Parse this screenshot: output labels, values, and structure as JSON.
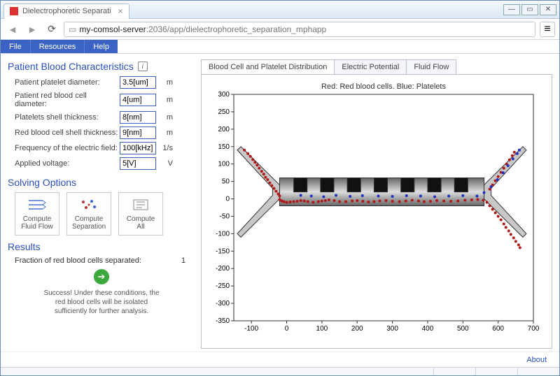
{
  "window": {
    "tab_title": "Dielectrophoretic Separati",
    "url_host": "my-comsol-server",
    "url_port": ":2036",
    "url_path": "/app/dielectrophoretic_separation_mphapp"
  },
  "menubar": [
    "File",
    "Resources",
    "Help"
  ],
  "sections": {
    "pbc_title": "Patient Blood Characteristics",
    "solving_title": "Solving Options",
    "results_title": "Results"
  },
  "fields": [
    {
      "label": "Patient platelet diameter:",
      "value": "3.5[um]",
      "unit": "m"
    },
    {
      "label": "Patient red blood cell diameter:",
      "value": "4[um]",
      "unit": "m"
    },
    {
      "label": "Platelets shell thickness:",
      "value": "8[nm]",
      "unit": "m"
    },
    {
      "label": "Red blood cell shell thickness:",
      "value": "9[nm]",
      "unit": "m"
    },
    {
      "label": "Frequency of the electric field:",
      "value": "100[kHz]",
      "unit": "1/s"
    },
    {
      "label": "Applied voltage:",
      "value": "5[V]",
      "unit": "V"
    }
  ],
  "buttons": {
    "compute_flow": "Compute\nFluid Flow",
    "compute_sep": "Compute\nSeparation",
    "compute_all": "Compute\nAll"
  },
  "results": {
    "fraction_label": "Fraction of red blood cells separated:",
    "fraction_value": "1",
    "success_msg": "Success! Under these conditions, the red blood cells will be isolated sufficiently for further analysis."
  },
  "tabs": [
    {
      "label": "Blood Cell and Platelet Distribution",
      "active": true
    },
    {
      "label": "Electric Potential",
      "active": false
    },
    {
      "label": "Fluid Flow",
      "active": false
    }
  ],
  "footer": {
    "about": "About"
  },
  "chart_data": {
    "type": "scatter",
    "title": "Red: Red blood cells. Blue: Platelets",
    "xlabel": "",
    "ylabel": "",
    "xlim": [
      -150,
      700
    ],
    "ylim": [
      -350,
      300
    ],
    "xticks": [
      -100,
      0,
      100,
      200,
      300,
      400,
      500,
      600,
      700
    ],
    "yticks": [
      -350,
      -300,
      -250,
      -200,
      -150,
      -100,
      -50,
      0,
      50,
      100,
      150,
      200,
      250,
      300
    ],
    "geometry_note": "Y-shaped microchannel with comb electrodes; particles along channel walls",
    "series": [
      {
        "name": "Red blood cells",
        "color": "#b01818",
        "points": [
          [
            -120,
            140
          ],
          [
            -110,
            130
          ],
          [
            -103,
            122
          ],
          [
            -96,
            113
          ],
          [
            -90,
            105
          ],
          [
            -84,
            97
          ],
          [
            -78,
            88
          ],
          [
            -71,
            79
          ],
          [
            -65,
            71
          ],
          [
            -60,
            62
          ],
          [
            -54,
            55
          ],
          [
            -48,
            46
          ],
          [
            -42,
            38
          ],
          [
            -36,
            30
          ],
          [
            -30,
            22
          ],
          [
            -24,
            14
          ],
          [
            -20,
            8
          ],
          [
            -20,
            -2
          ],
          [
            -14,
            -6
          ],
          [
            -8,
            -8
          ],
          [
            0,
            -10
          ],
          [
            10,
            -9
          ],
          [
            20,
            -8
          ],
          [
            30,
            -7
          ],
          [
            40,
            -5
          ],
          [
            50,
            -6
          ],
          [
            60,
            -8
          ],
          [
            75,
            -10
          ],
          [
            90,
            -8
          ],
          [
            100,
            -6
          ],
          [
            110,
            -5
          ],
          [
            120,
            -3
          ],
          [
            135,
            -5
          ],
          [
            150,
            -8
          ],
          [
            168,
            -8
          ],
          [
            186,
            -6
          ],
          [
            200,
            -5
          ],
          [
            216,
            -7
          ],
          [
            232,
            -9
          ],
          [
            248,
            -8
          ],
          [
            264,
            -6
          ],
          [
            282,
            -5
          ],
          [
            300,
            -7
          ],
          [
            320,
            -8
          ],
          [
            338,
            -6
          ],
          [
            356,
            -4
          ],
          [
            374,
            -6
          ],
          [
            390,
            -8
          ],
          [
            408,
            -7
          ],
          [
            426,
            -5
          ],
          [
            446,
            -6
          ],
          [
            466,
            -7
          ],
          [
            486,
            -6
          ],
          [
            506,
            -4
          ],
          [
            525,
            -3
          ],
          [
            542,
            -2
          ],
          [
            558,
            -4
          ],
          [
            568,
            -10
          ],
          [
            576,
            -20
          ],
          [
            584,
            -30
          ],
          [
            592,
            -40
          ],
          [
            600,
            -50
          ],
          [
            608,
            -60
          ],
          [
            616,
            -72
          ],
          [
            622,
            -82
          ],
          [
            630,
            -92
          ],
          [
            636,
            -102
          ],
          [
            644,
            -112
          ],
          [
            650,
            -122
          ],
          [
            658,
            -132
          ],
          [
            662,
            -140
          ],
          [
            576,
            28
          ],
          [
            584,
            40
          ],
          [
            592,
            52
          ],
          [
            600,
            64
          ],
          [
            608,
            76
          ],
          [
            616,
            88
          ],
          [
            624,
            100
          ],
          [
            632,
            112
          ],
          [
            640,
            124
          ],
          [
            646,
            134
          ]
        ]
      },
      {
        "name": "Platelets",
        "color": "#2030c0",
        "points": [
          [
            40,
            10
          ],
          [
            70,
            8
          ],
          [
            105,
            6
          ],
          [
            140,
            10
          ],
          [
            180,
            7
          ],
          [
            215,
            9
          ],
          [
            260,
            8
          ],
          [
            300,
            7
          ],
          [
            340,
            9
          ],
          [
            380,
            8
          ],
          [
            420,
            6
          ],
          [
            460,
            8
          ],
          [
            500,
            9
          ],
          [
            540,
            8
          ],
          [
            560,
            18
          ],
          [
            580,
            35
          ],
          [
            598,
            55
          ],
          [
            614,
            75
          ],
          [
            628,
            95
          ],
          [
            642,
            115
          ],
          [
            654,
            130
          ],
          [
            660,
            140
          ]
        ]
      }
    ]
  }
}
